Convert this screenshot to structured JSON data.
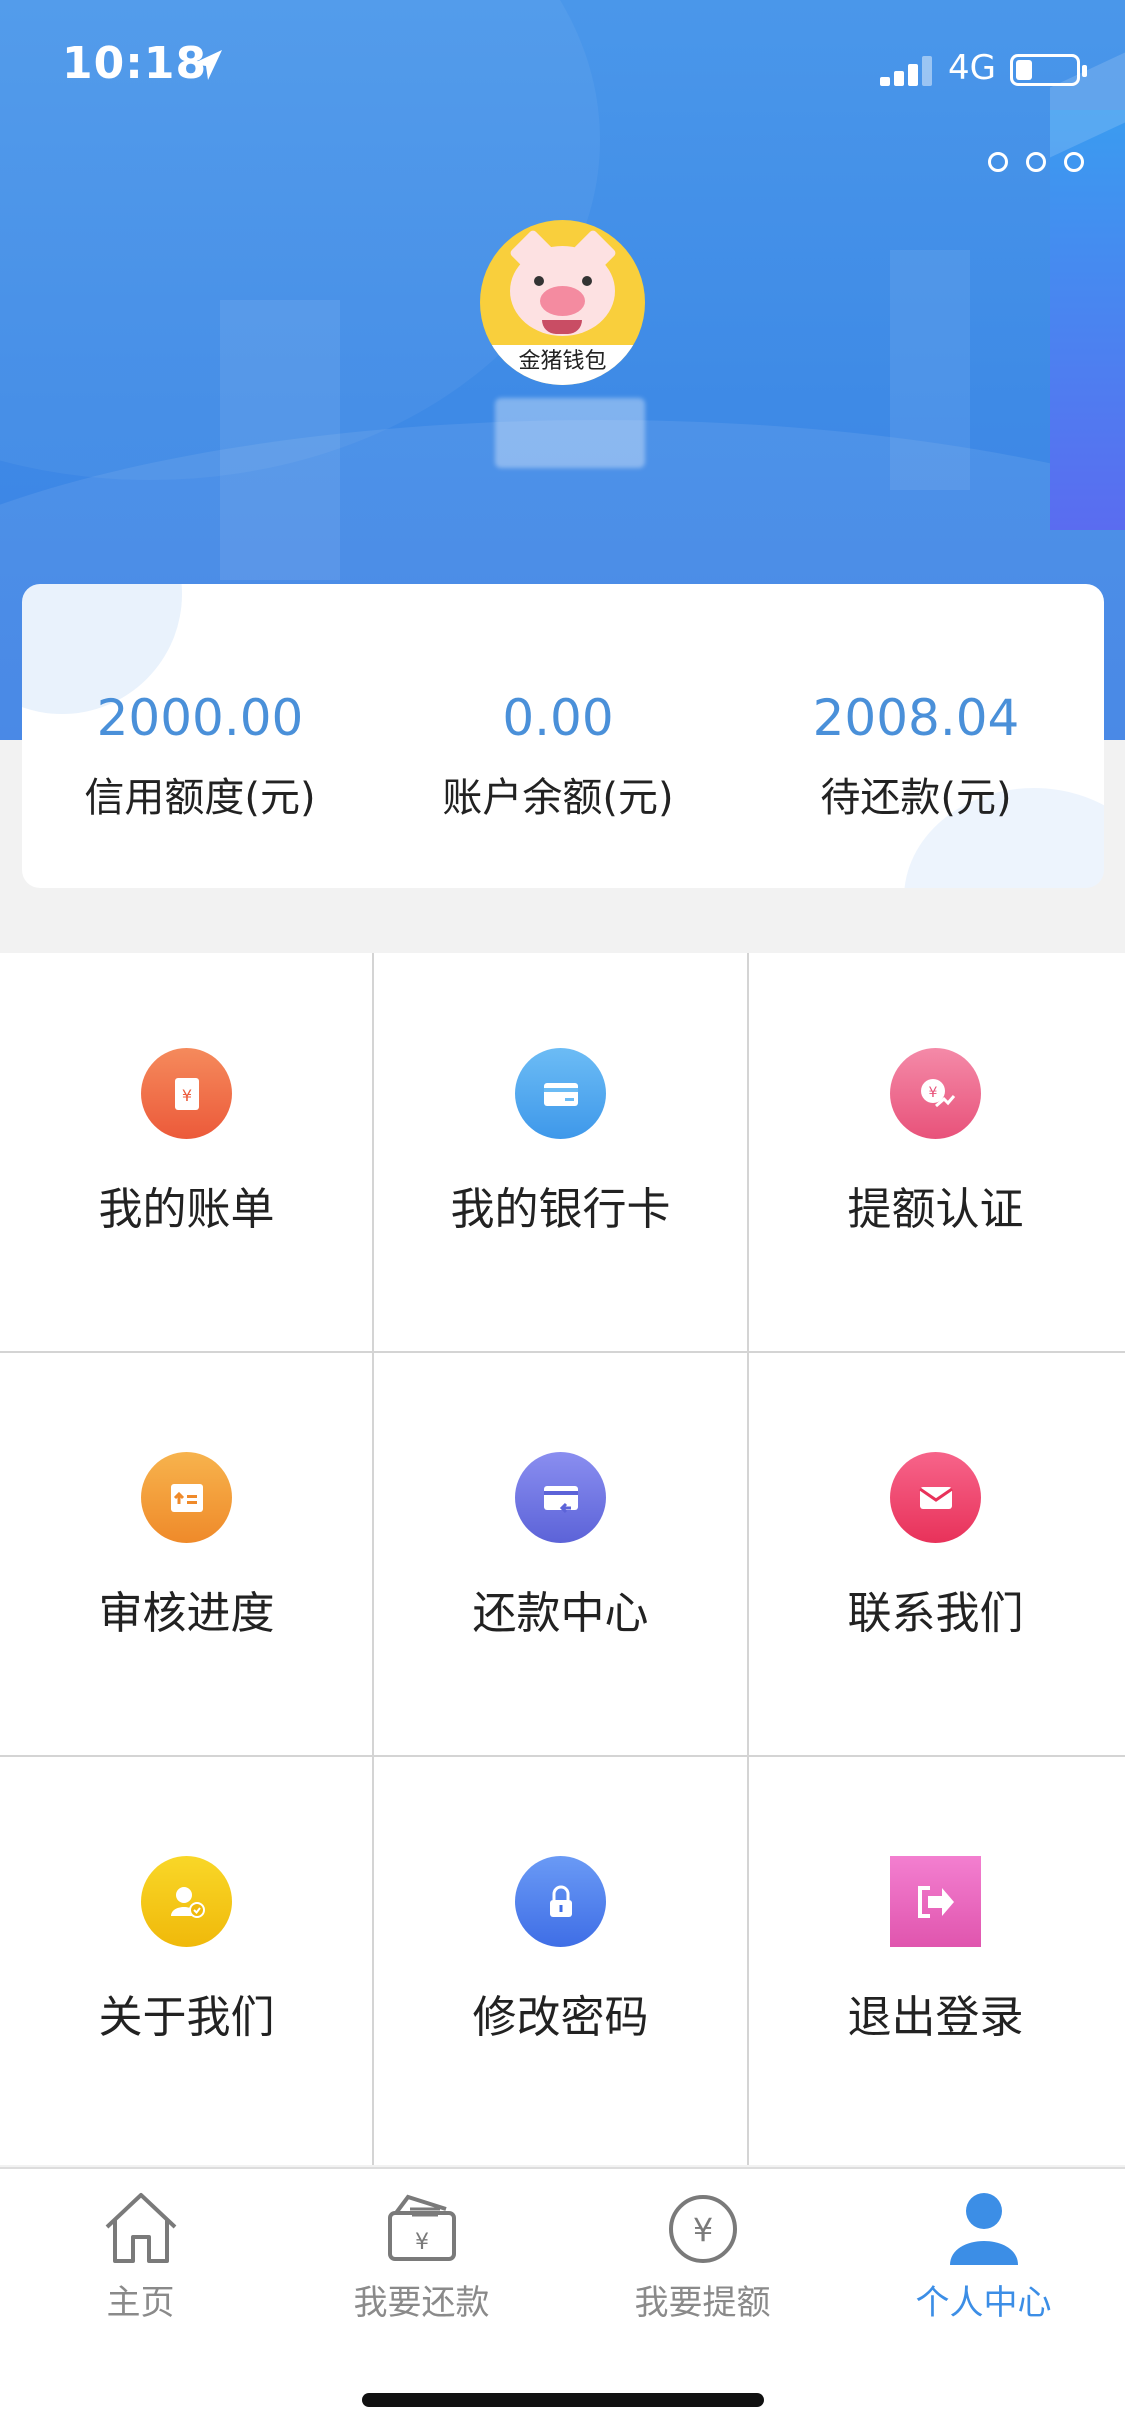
{
  "status_bar": {
    "time": "10:18",
    "network": "4G"
  },
  "profile": {
    "app_badge": "金猪钱包"
  },
  "stats": [
    {
      "value": "2000.00",
      "label": "信用额度(元)"
    },
    {
      "value": "0.00",
      "label": "账户余额(元)"
    },
    {
      "value": "2008.04",
      "label": "待还款(元)"
    }
  ],
  "menu": [
    {
      "label": "我的账单",
      "icon": "bill-icon",
      "color": "#f06a4a"
    },
    {
      "label": "我的银行卡",
      "icon": "bank-card-icon",
      "color": "#4aa6ef"
    },
    {
      "label": "提额认证",
      "icon": "raise-limit-icon",
      "color": "#ee5f86"
    },
    {
      "label": "审核进度",
      "icon": "review-progress-icon",
      "color": "#f49a32"
    },
    {
      "label": "还款中心",
      "icon": "repayment-icon",
      "color": "#6a72e6"
    },
    {
      "label": "联系我们",
      "icon": "mail-icon",
      "color": "#f0456a"
    },
    {
      "label": "关于我们",
      "icon": "about-user-icon",
      "color": "#f5c20f"
    },
    {
      "label": "修改密码",
      "icon": "lock-icon",
      "color": "#4e7ff0"
    },
    {
      "label": "退出登录",
      "icon": "logout-icon",
      "color": "#ee6ac0"
    }
  ],
  "tabs": [
    {
      "label": "主页",
      "icon": "home-icon"
    },
    {
      "label": "我要还款",
      "icon": "wallet-icon"
    },
    {
      "label": "我要提额",
      "icon": "yen-circle-icon"
    },
    {
      "label": "个人中心",
      "icon": "person-icon",
      "active": true
    }
  ],
  "colors": {
    "header_blue": "#4a97ea",
    "accent": "#3c8ee6",
    "stat_value": "#4a90d9"
  }
}
